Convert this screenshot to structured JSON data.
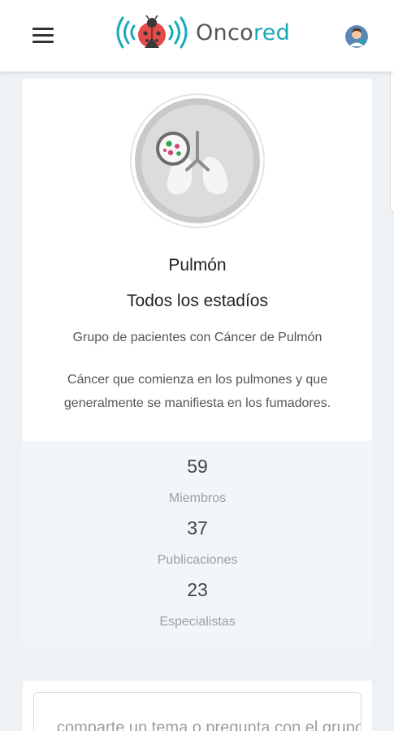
{
  "header": {
    "menu_icon": "hamburger-menu-icon",
    "logo_text_prefix": "Onco",
    "logo_text_suffix": "red",
    "logo_icon": "ladybug-signal-icon",
    "avatar_icon": "doctor-avatar-icon",
    "colors": {
      "brand_red": "#e34b4b",
      "brand_cyan": "#19a9b7"
    }
  },
  "group": {
    "icon": "lung-petri-dish-icon",
    "title": "Pulmón",
    "stage": "Todos los estadíos",
    "subtitle": "Grupo de pacientes con Cáncer de Pulmón",
    "description": "Cáncer que comienza en los pulmones y que generalmente se manifiesta en los fumadores."
  },
  "stats": {
    "members": {
      "value": "59",
      "label": "Miembros"
    },
    "posts": {
      "value": "37",
      "label": "Publicaciones"
    },
    "specialists": {
      "value": "23",
      "label": "Especialistas"
    }
  },
  "compose": {
    "placeholder": "comparte un tema o pregunta con el grupo"
  }
}
